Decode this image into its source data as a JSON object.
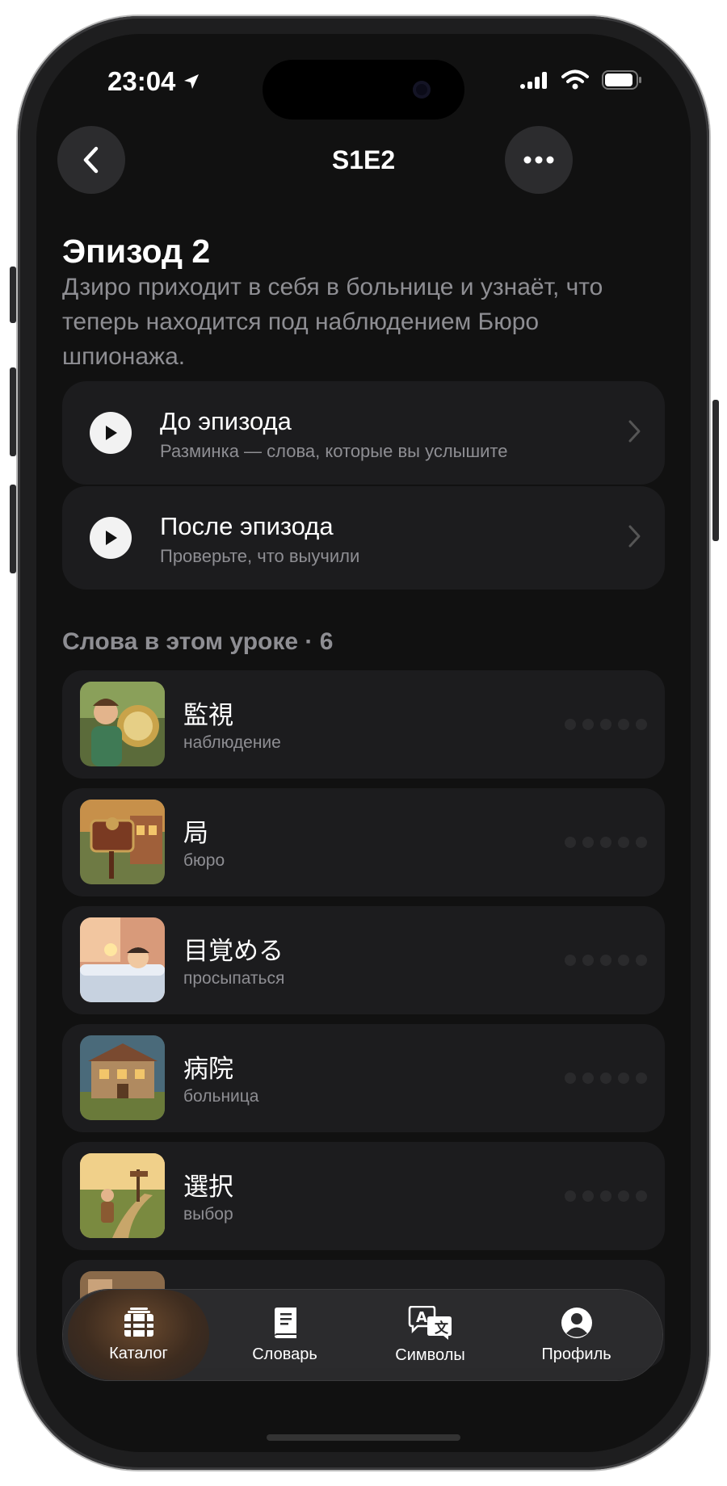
{
  "status_bar": {
    "time": "23:04"
  },
  "nav": {
    "title": "S1E2"
  },
  "episode": {
    "title": "Эпизод 2",
    "description": "Дзиро приходит в себя в больнице и узнаёт, что теперь находится под наблюдением Бюро шпионажа."
  },
  "actions": [
    {
      "title": "До эпизода",
      "subtitle": "Разминка — слова, которые вы услышите"
    },
    {
      "title": "После эпизода",
      "subtitle": "Проверьте, что выучили"
    }
  ],
  "words_section": {
    "title": "Слова в этом уроке · 6"
  },
  "words": [
    {
      "kanji": "監視",
      "translation": "наблюдение",
      "progress": 0
    },
    {
      "kanji": "局",
      "translation": "бюро",
      "progress": 0
    },
    {
      "kanji": "目覚める",
      "translation": "просыпаться",
      "progress": 0
    },
    {
      "kanji": "病院",
      "translation": "больница",
      "progress": 0
    },
    {
      "kanji": "選択",
      "translation": "выбор",
      "progress": 0
    }
  ],
  "tabbar": {
    "items": [
      {
        "label": "Каталог",
        "icon": "film-icon",
        "active": true
      },
      {
        "label": "Словарь",
        "icon": "book-icon",
        "active": false
      },
      {
        "label": "Символы",
        "icon": "translate-icon",
        "active": false
      },
      {
        "label": "Профиль",
        "icon": "profile-icon",
        "active": false
      }
    ]
  }
}
